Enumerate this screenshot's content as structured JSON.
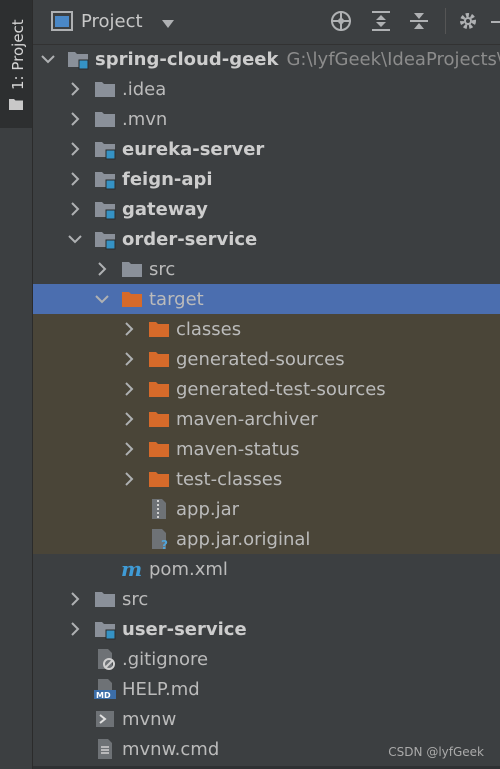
{
  "side_tab": {
    "label": "1: Project"
  },
  "header": {
    "title": "Project"
  },
  "tree": [
    {
      "label": "spring-cloud-geek",
      "path": "G:\\lyfGeek\\IdeaProjects\\sp",
      "depth": 0,
      "expanded": true,
      "icon": "module-folder",
      "bold": true
    },
    {
      "label": ".idea",
      "depth": 1,
      "expanded": false,
      "icon": "folder"
    },
    {
      "label": ".mvn",
      "depth": 1,
      "expanded": false,
      "icon": "folder"
    },
    {
      "label": "eureka-server",
      "depth": 1,
      "expanded": false,
      "icon": "module-folder",
      "bold": true
    },
    {
      "label": "feign-api",
      "depth": 1,
      "expanded": false,
      "icon": "module-folder",
      "bold": true
    },
    {
      "label": "gateway",
      "depth": 1,
      "expanded": false,
      "icon": "module-folder",
      "bold": true
    },
    {
      "label": "order-service",
      "depth": 1,
      "expanded": true,
      "icon": "module-folder",
      "bold": true
    },
    {
      "label": "src",
      "depth": 2,
      "expanded": false,
      "icon": "folder"
    },
    {
      "label": "target",
      "depth": 2,
      "expanded": true,
      "icon": "excluded-folder",
      "selected": true
    },
    {
      "label": "classes",
      "depth": 3,
      "expanded": false,
      "icon": "excluded-folder",
      "excluded": true
    },
    {
      "label": "generated-sources",
      "depth": 3,
      "expanded": false,
      "icon": "excluded-folder",
      "excluded": true
    },
    {
      "label": "generated-test-sources",
      "depth": 3,
      "expanded": false,
      "icon": "excluded-folder",
      "excluded": true
    },
    {
      "label": "maven-archiver",
      "depth": 3,
      "expanded": false,
      "icon": "excluded-folder",
      "excluded": true
    },
    {
      "label": "maven-status",
      "depth": 3,
      "expanded": false,
      "icon": "excluded-folder",
      "excluded": true
    },
    {
      "label": "test-classes",
      "depth": 3,
      "expanded": false,
      "icon": "excluded-folder",
      "excluded": true
    },
    {
      "label": "app.jar",
      "depth": 3,
      "leaf": true,
      "icon": "jar-file",
      "excluded": true
    },
    {
      "label": "app.jar.original",
      "depth": 3,
      "leaf": true,
      "icon": "unknown-file",
      "excluded": true
    },
    {
      "label": "pom.xml",
      "depth": 2,
      "leaf": true,
      "icon": "maven-file"
    },
    {
      "label": "src",
      "depth": 1,
      "expanded": false,
      "icon": "folder"
    },
    {
      "label": "user-service",
      "depth": 1,
      "expanded": false,
      "icon": "module-folder",
      "bold": true
    },
    {
      "label": ".gitignore",
      "depth": 1,
      "leaf": true,
      "icon": "gitignore-file"
    },
    {
      "label": "HELP.md",
      "depth": 1,
      "leaf": true,
      "icon": "markdown-file"
    },
    {
      "label": "mvnw",
      "depth": 1,
      "leaf": true,
      "icon": "shell-file"
    },
    {
      "label": "mvnw.cmd",
      "depth": 1,
      "leaf": true,
      "icon": "text-file"
    }
  ],
  "watermark": "CSDN @lyfGeek"
}
